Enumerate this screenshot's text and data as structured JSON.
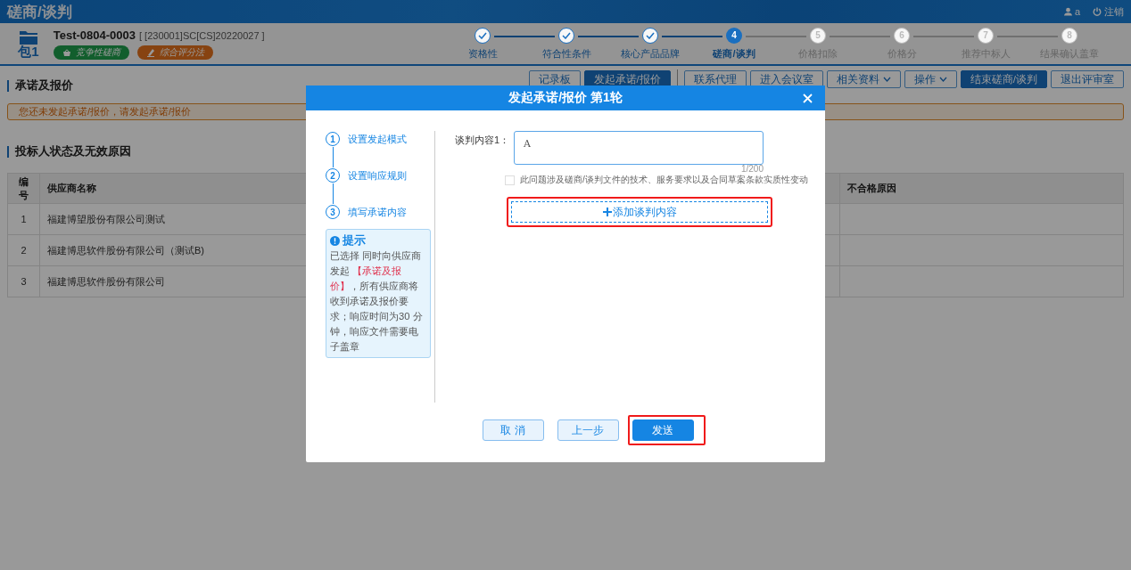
{
  "app": {
    "title": "磋商/谈判",
    "user": "a",
    "logout": "注销"
  },
  "project": {
    "package": "包1",
    "name": "Test-0804-0003",
    "code": "[ [230001]SC[CS]20220027 ]",
    "tags": [
      {
        "label": "竞争性磋商",
        "kind": "method"
      },
      {
        "label": "综合评分法",
        "kind": "scoring"
      }
    ]
  },
  "steps": [
    {
      "label": "资格性",
      "done": true,
      "active": false
    },
    {
      "label": "符合性条件",
      "done": true,
      "active": false
    },
    {
      "label": "核心产品品牌",
      "done": true,
      "active": false
    },
    {
      "number": "4",
      "label": "磋商/谈判",
      "done": false,
      "active": true
    },
    {
      "number": "5",
      "label": "价格扣除",
      "done": false,
      "active": false
    },
    {
      "number": "6",
      "label": "价格分",
      "done": false,
      "active": false
    },
    {
      "number": "7",
      "label": "推荐中标人",
      "done": false,
      "active": false
    },
    {
      "number": "8",
      "label": "结果确认盖章",
      "done": false,
      "active": false
    }
  ],
  "section": {
    "title": "承诺及报价"
  },
  "toolbar": [
    {
      "label": "记录板",
      "kind": "plain"
    },
    {
      "label": "发起承诺/报价",
      "kind": "primary"
    },
    {
      "label": "联系代理",
      "kind": "plain"
    },
    {
      "label": "进入会议室",
      "kind": "plain"
    },
    {
      "label": "相关资料",
      "kind": "dropdown"
    },
    {
      "label": "操作",
      "kind": "dropdown"
    },
    {
      "label": "结束磋商/谈判",
      "kind": "primary"
    },
    {
      "label": "退出评审室",
      "kind": "plain"
    }
  ],
  "alert": "您还未发起承诺/报价，请发起承诺/报价",
  "bidders": {
    "title": "投标人状态及无效原因",
    "columns": [
      "编号",
      "供应商名称",
      "不合格原因"
    ],
    "rows": [
      {
        "number": "1",
        "name": "福建博望股份有限公司测试"
      },
      {
        "number": "2",
        "name": "福建博思软件股份有限公司（测试B)"
      },
      {
        "number": "3",
        "name": "福建博思软件股份有限公司"
      }
    ]
  },
  "dialog": {
    "title": "发起承诺/报价 第1轮",
    "steps": [
      {
        "number": "1",
        "label": "设置发起模式"
      },
      {
        "number": "2",
        "label": "设置响应规则"
      },
      {
        "number": "3",
        "label": "填写承诺内容"
      }
    ],
    "tip": {
      "title": "提示",
      "parts": [
        {
          "text": "已选择 同时向供应商发起 ",
          "kind": "plain"
        },
        {
          "text": "【承诺及报价】",
          "kind": "highlight"
        },
        {
          "text": "，所有供应商将收到承诺及报价要求；响应时间为30 分钟，响应文件需要电子盖章",
          "kind": "plain"
        }
      ]
    },
    "content": {
      "label": "谈判内容1：",
      "value": "A",
      "counter": "1/200",
      "checkbox": {
        "label": "此问题涉及磋商/谈判文件的技术、服务要求以及合同草案条款实质性变动",
        "checked": false
      }
    },
    "add_button": {
      "label": "添加谈判内容",
      "highlighted": true
    },
    "buttons": [
      {
        "label": "取 消",
        "kind": "secondary",
        "highlighted": false
      },
      {
        "label": "上一步",
        "kind": "secondary",
        "highlighted": false
      },
      {
        "label": "发送",
        "kind": "primary",
        "highlighted": true
      }
    ]
  }
}
